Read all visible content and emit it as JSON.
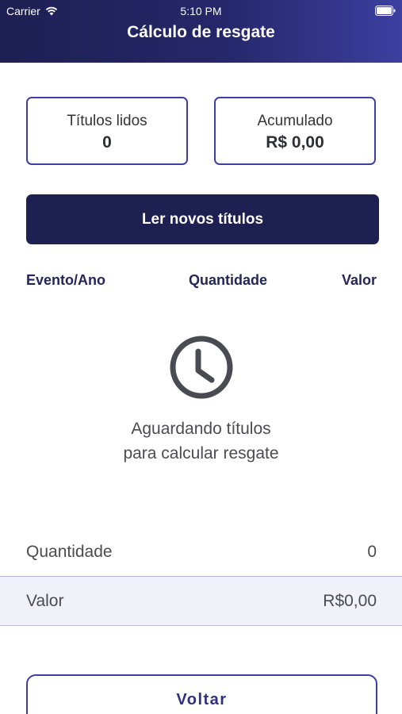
{
  "status_bar": {
    "carrier": "Carrier",
    "time": "5:10 PM"
  },
  "header": {
    "title": "Cálculo de resgate"
  },
  "cards": {
    "read": {
      "label": "Títulos lidos",
      "value": "0"
    },
    "accumulated": {
      "label": "Acumulado",
      "value": "R$ 0,00"
    }
  },
  "actions": {
    "read_button": "Ler novos títulos",
    "back_button": "Voltar"
  },
  "table": {
    "columns": [
      "Evento/Ano",
      "Quantidade",
      "Valor"
    ]
  },
  "empty_state": {
    "line1": "Aguardando títulos",
    "line2": "para calcular resgate"
  },
  "summary": {
    "quantity": {
      "label": "Quantidade",
      "value": "0"
    },
    "value": {
      "label": "Valor",
      "value": "R$0,00"
    }
  },
  "colors": {
    "primary": "#1f2052",
    "accent": "#3d3fa3",
    "highlight_row": "#f0f1f9"
  }
}
